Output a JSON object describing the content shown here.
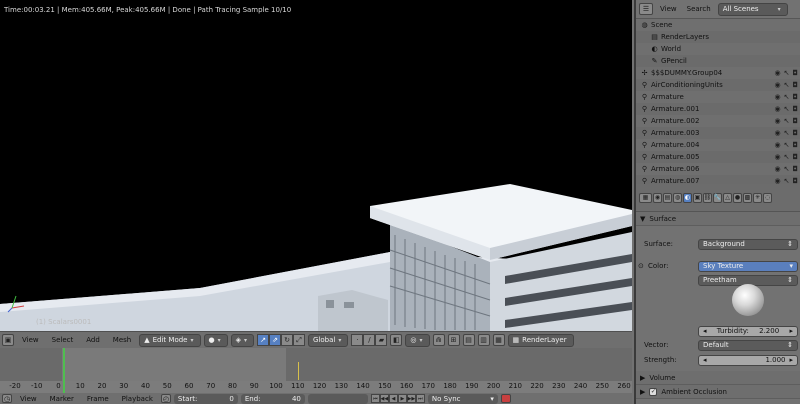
{
  "viewport": {
    "status": "Time:00:03.21 | Mem:405.66M, Peak:405.66M | Done | Path Tracing Sample 10/10",
    "object_name": "(1) Scalars0001"
  },
  "view_header": {
    "menus": [
      "View",
      "Select",
      "Add",
      "Mesh"
    ],
    "mode": "Edit Mode",
    "orientation": "Global",
    "render_layer": "RenderLayer"
  },
  "timeline": {
    "ticks": [
      "-20",
      "-10",
      "0",
      "10",
      "20",
      "30",
      "40",
      "50",
      "60",
      "70",
      "80",
      "90",
      "100",
      "110",
      "120",
      "130",
      "140",
      "150",
      "160",
      "170",
      "180",
      "190",
      "200",
      "210",
      "220",
      "230",
      "240",
      "250",
      "260"
    ],
    "current_frame": 0
  },
  "timeline_header": {
    "menus": [
      "View",
      "Marker",
      "Frame",
      "Playback"
    ],
    "start_label": "Start:",
    "start_value": "0",
    "end_label": "End:",
    "end_value": "40",
    "sync": "No Sync"
  },
  "outliner": {
    "view_label": "View",
    "search_label": "Search",
    "filter": "All Scenes",
    "items": [
      {
        "label": "Scene",
        "icon": "scene-icon"
      },
      {
        "label": "RenderLayers",
        "icon": "renderlayers-icon"
      },
      {
        "label": "World",
        "icon": "world-icon"
      },
      {
        "label": "GPencil",
        "icon": "gpencil-icon"
      },
      {
        "label": "$$$DUMMY.Group04",
        "icon": "empty-icon"
      },
      {
        "label": "AirConditioningUnits",
        "icon": "armature-icon"
      },
      {
        "label": "Armature",
        "icon": "armature-icon"
      },
      {
        "label": "Armature.001",
        "icon": "armature-icon"
      },
      {
        "label": "Armature.002",
        "icon": "armature-icon"
      },
      {
        "label": "Armature.003",
        "icon": "armature-icon"
      },
      {
        "label": "Armature.004",
        "icon": "armature-icon"
      },
      {
        "label": "Armature.005",
        "icon": "armature-icon"
      },
      {
        "label": "Armature.006",
        "icon": "armature-icon"
      },
      {
        "label": "Armature.007",
        "icon": "armature-icon"
      }
    ]
  },
  "properties": {
    "surface_header": "Surface",
    "surface_label": "Surface:",
    "surface_value": "Background",
    "color_label": "Color:",
    "color_value": "Sky Texture",
    "sky_type": "Preetham",
    "turbidity_label": "Turbidity:",
    "turbidity_value": "2.200",
    "vector_label": "Vector:",
    "vector_value": "Default",
    "strength_label": "Strength:",
    "strength_value": "1.000",
    "volume_header": "Volume",
    "ao_header": "Ambient Occlusion"
  },
  "colors": {
    "current_frame": "#4fbe4f",
    "selected_field": "#5a7fbd"
  }
}
